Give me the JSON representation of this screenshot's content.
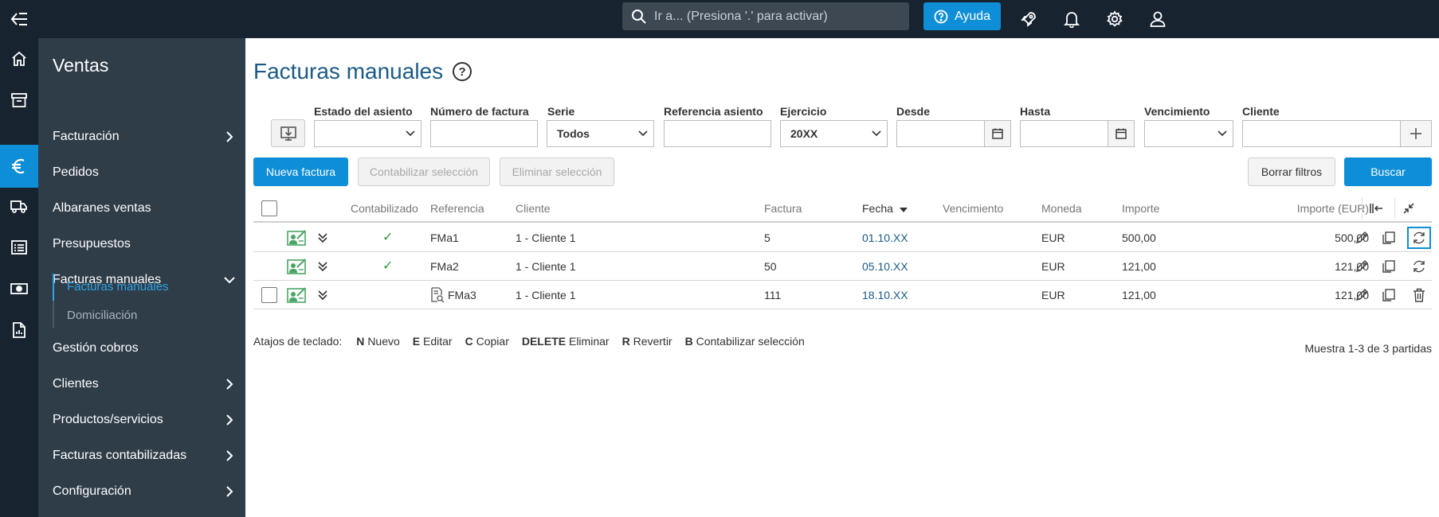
{
  "topbar": {
    "search_placeholder": "Ir a... (Presiona '.' para activar)",
    "help_label": "Ayuda",
    "icons": [
      "collapse-menu-icon",
      "search-icon",
      "help-icon",
      "rocket-icon",
      "bell-icon",
      "gear-icon",
      "user-icon"
    ]
  },
  "rail": {
    "items": [
      "home-icon",
      "archive-icon",
      "euro-icon",
      "truck-icon",
      "list-icon",
      "money-icon",
      "report-icon"
    ],
    "active": "euro-icon"
  },
  "sidemenu": {
    "title": "Ventas",
    "items": [
      {
        "label": "Facturación"
      },
      {
        "label": "Pedidos"
      },
      {
        "label": "Albaranes ventas"
      },
      {
        "label": "Presupuestos"
      },
      {
        "label": "Facturas manuales"
      },
      {
        "label": "Gestión cobros"
      },
      {
        "label": "Clientes"
      },
      {
        "label": "Productos/servicios"
      },
      {
        "label": "Facturas contabilizadas"
      },
      {
        "label": "Configuración"
      }
    ],
    "subitems": [
      {
        "label": "Facturas manuales",
        "active": true
      },
      {
        "label": "Domiciliación",
        "active": false
      }
    ]
  },
  "page": {
    "title": "Facturas manuales",
    "help": "?"
  },
  "filters": {
    "estado_asiento": {
      "label": "Estado del asiento",
      "value": ""
    },
    "numero_factura": {
      "label": "Número de factura",
      "value": ""
    },
    "serie": {
      "label": "Serie",
      "value": "Todos"
    },
    "referencia_asiento": {
      "label": "Referencia asiento",
      "value": ""
    },
    "ejercicio": {
      "label": "Ejercicio",
      "value": "20XX"
    },
    "desde": {
      "label": "Desde",
      "value": ""
    },
    "hasta": {
      "label": "Hasta",
      "value": ""
    },
    "vencimiento": {
      "label": "Vencimiento",
      "value": ""
    },
    "cliente": {
      "label": "Cliente",
      "value": ""
    }
  },
  "actions": {
    "nueva_factura": "Nueva factura",
    "contabilizar": "Contabilizar selección",
    "eliminar": "Eliminar selección",
    "borrar_filtros": "Borrar filtros",
    "buscar": "Buscar"
  },
  "table": {
    "headers": {
      "contabilizado": "Contabilizado",
      "referencia": "Referencia",
      "cliente": "Cliente",
      "factura": "Factura",
      "fecha": "Fecha",
      "vencimiento": "Vencimiento",
      "moneda": "Moneda",
      "importe": "Importe",
      "importe_eur": "Importe (EUR)"
    },
    "rows": [
      {
        "contabilizado": "✓",
        "referencia": "FMa1",
        "cliente": "1 - Cliente 1",
        "factura": "5",
        "fecha": "01.10.XX",
        "vencimiento": "",
        "moneda": "EUR",
        "importe": "500,00",
        "importe_eur": "500,00"
      },
      {
        "contabilizado": "✓",
        "referencia": "FMa2",
        "cliente": "1 - Cliente 1",
        "factura": "50",
        "fecha": "05.10.XX",
        "vencimiento": "",
        "moneda": "EUR",
        "importe": "121,00",
        "importe_eur": "121,00"
      },
      {
        "contabilizado": "",
        "referencia": "FMa3",
        "cliente": "1 - Cliente 1",
        "factura": "111",
        "fecha": "18.10.XX",
        "vencimiento": "",
        "moneda": "EUR",
        "importe": "121,00",
        "importe_eur": "121,00"
      }
    ]
  },
  "shortcuts": {
    "prefix": "Atajos de teclado:",
    "items": [
      {
        "key": "N",
        "label": "Nuevo"
      },
      {
        "key": "E",
        "label": "Editar"
      },
      {
        "key": "C",
        "label": "Copiar"
      },
      {
        "key": "DELETE",
        "label": "Eliminar"
      },
      {
        "key": "R",
        "label": "Revertir"
      },
      {
        "key": "B",
        "label": "Contabilizar selección"
      }
    ]
  },
  "summary": "Muestra 1-3 de 3 partidas",
  "colors": {
    "topbar": "#17232f",
    "sidemenu": "#2f3d48",
    "accent": "#0e8ed6",
    "title": "#1b5a86",
    "check": "#2e9a3e"
  }
}
